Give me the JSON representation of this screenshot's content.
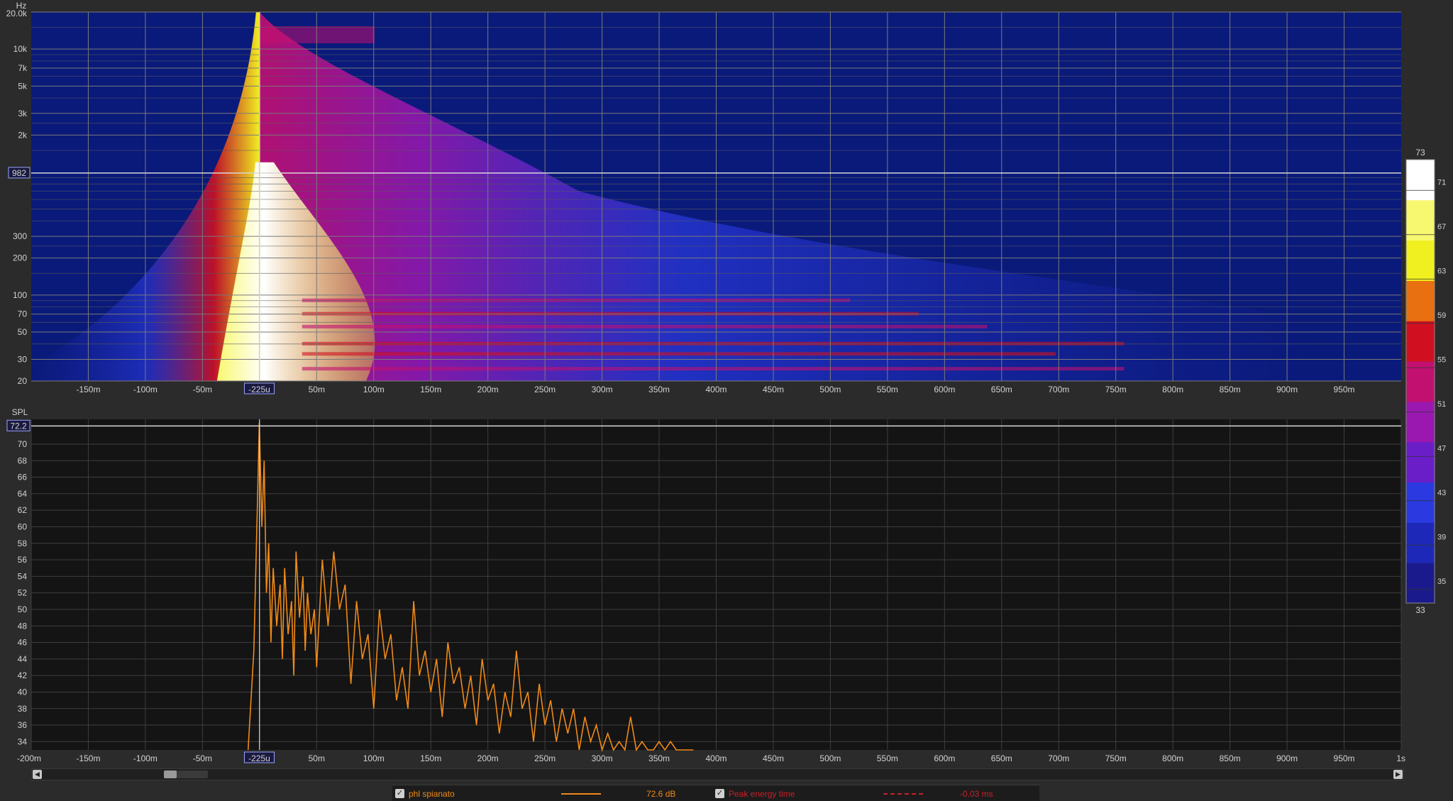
{
  "colors": {
    "background": "#2b2b2b",
    "plot_background_top": "#0a1a7a",
    "plot_background_bottom": "#141414",
    "grid": "#5b5b5b",
    "trace": "#f08a18",
    "peak_line": "#c8202a",
    "cursor": "#d8d8d8"
  },
  "chart_data": [
    {
      "type": "heatmap",
      "title": "",
      "ylabel": "Hz",
      "xlabel": "",
      "x_tick_labels": [
        "-150m",
        "-100m",
        "-50m",
        "-225u",
        "50m",
        "100m",
        "150m",
        "200m",
        "250m",
        "300m",
        "350m",
        "400m",
        "450m",
        "500m",
        "550m",
        "600m",
        "650m",
        "700m",
        "750m",
        "800m",
        "850m",
        "900m",
        "950m"
      ],
      "y_tick_labels": [
        "20.0k",
        "10k",
        "7k",
        "5k",
        "3k",
        "2k",
        "982",
        "300",
        "200",
        "100",
        "70",
        "50",
        "30",
        "20"
      ],
      "x_cursor_label": "-225u",
      "y_cursor_label": "982",
      "xlim_s": [
        -0.2,
        1.0
      ],
      "ylim_hz": [
        20,
        20000
      ],
      "y_scale": "log",
      "colorbar": {
        "min_label": "33",
        "max_label": "73",
        "tick_labels": [
          "71",
          "67",
          "63",
          "59",
          "55",
          "51",
          "47",
          "43",
          "39",
          "35"
        ],
        "colors": [
          "#1a1a8c",
          "#1e28b8",
          "#2a3ae0",
          "#6a1ec8",
          "#9a18b0",
          "#c21070",
          "#d01020",
          "#e87010",
          "#f0f020",
          "#f8f870",
          "#ffffff"
        ]
      }
    },
    {
      "type": "line",
      "title": "",
      "ylabel": "SPL",
      "xlabel": "",
      "x_tick_labels": [
        "-200m",
        "-150m",
        "-100m",
        "-50m",
        "-225u",
        "50m",
        "100m",
        "150m",
        "200m",
        "250m",
        "300m",
        "350m",
        "400m",
        "450m",
        "500m",
        "550m",
        "600m",
        "650m",
        "700m",
        "750m",
        "800m",
        "850m",
        "900m",
        "950m",
        "1s"
      ],
      "y_tick_labels": [
        "72.2",
        "70",
        "68",
        "66",
        "64",
        "62",
        "60",
        "58",
        "56",
        "54",
        "52",
        "50",
        "48",
        "46",
        "44",
        "42",
        "40",
        "38",
        "36",
        "34"
      ],
      "y_cursor_label": "72.2",
      "x_cursor_label": "-225u",
      "xlim_s": [
        -0.2,
        1.0
      ],
      "ylim_db": [
        33,
        73
      ],
      "series": [
        {
          "name": "phl spianato",
          "x_ms": [
            -10,
            -5,
            -2,
            -0.2,
            2,
            4,
            6,
            8,
            10,
            12,
            15,
            18,
            20,
            22,
            25,
            28,
            30,
            32,
            35,
            38,
            40,
            42,
            45,
            48,
            50,
            55,
            60,
            65,
            70,
            75,
            80,
            85,
            90,
            95,
            100,
            105,
            110,
            115,
            120,
            125,
            130,
            135,
            140,
            145,
            150,
            155,
            160,
            165,
            170,
            175,
            180,
            185,
            190,
            195,
            200,
            205,
            210,
            215,
            220,
            225,
            230,
            235,
            240,
            245,
            250,
            255,
            260,
            265,
            270,
            275,
            280,
            285,
            290,
            295,
            300,
            305,
            310,
            315,
            320,
            325,
            330,
            335,
            340,
            345,
            350,
            355,
            360,
            365,
            370,
            375,
            380
          ],
          "y_db": [
            33,
            45,
            62,
            72.6,
            60,
            68,
            52,
            58,
            46,
            55,
            48,
            53,
            44,
            55,
            47,
            51,
            42,
            57,
            49,
            54,
            45,
            52,
            47,
            50,
            43,
            56,
            48,
            57,
            50,
            53,
            41,
            51,
            44,
            47,
            38,
            50,
            44,
            47,
            39,
            43,
            38,
            51,
            42,
            45,
            40,
            44,
            37,
            46,
            41,
            43,
            38,
            42,
            36,
            44,
            39,
            41,
            35,
            40,
            37,
            45,
            38,
            40,
            34,
            41,
            36,
            39,
            34,
            38,
            35,
            38,
            33,
            37,
            34,
            36,
            33,
            35,
            33,
            34,
            33,
            37,
            33,
            34,
            33,
            33,
            34,
            33,
            34,
            33,
            33,
            33,
            33
          ]
        }
      ],
      "peak_energy_time_ms": -0.03
    }
  ],
  "legend": {
    "items": [
      {
        "label": "phl spianato",
        "value": "72.6 dB",
        "checked": true
      },
      {
        "label": "Peak energy time",
        "value": "-0.03 ms",
        "checked": true
      }
    ]
  }
}
